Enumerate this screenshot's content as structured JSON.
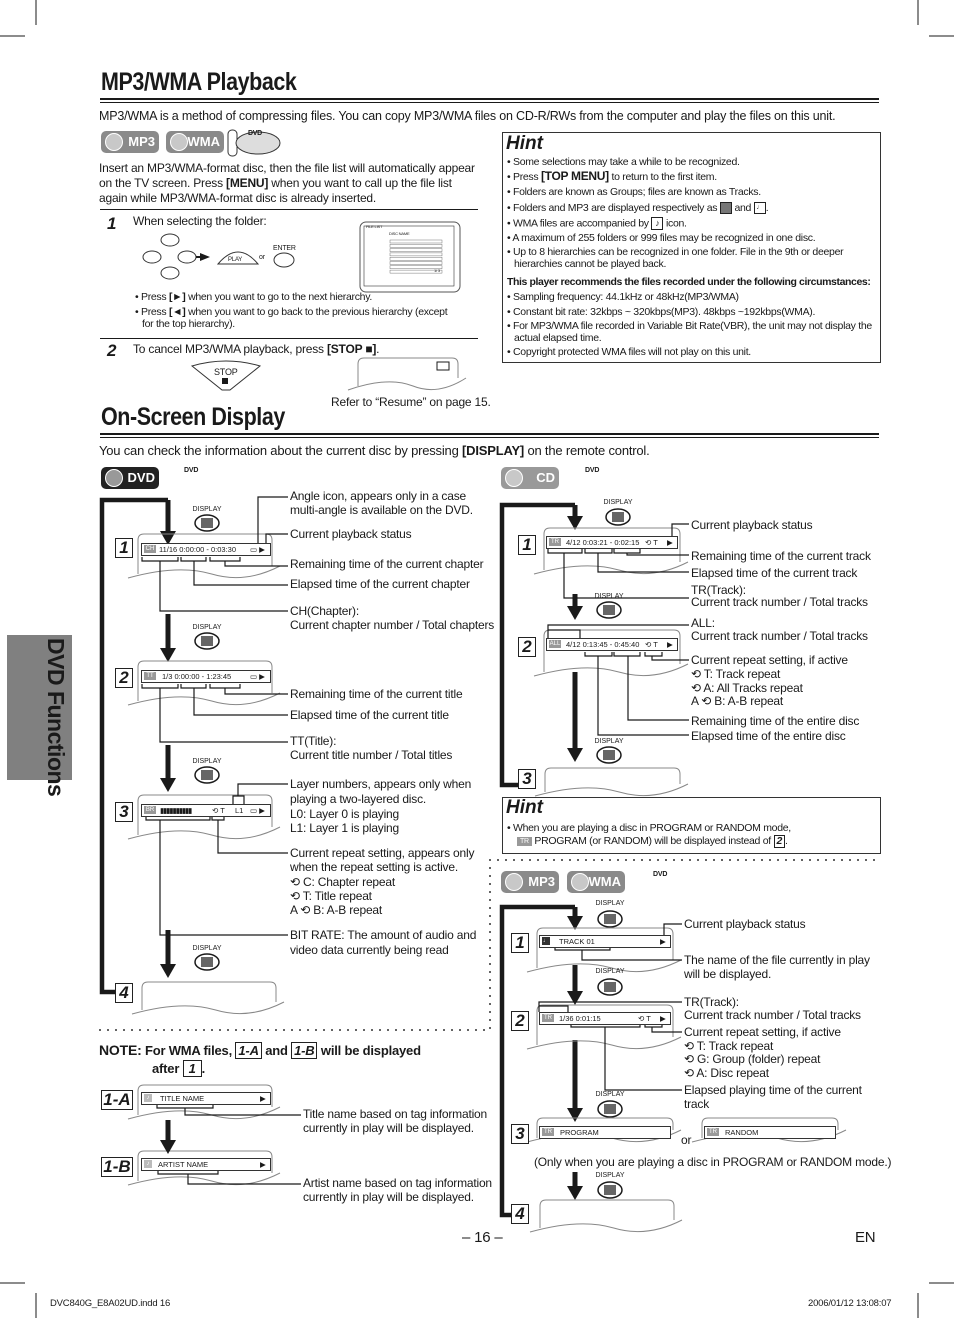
{
  "mp3wma": {
    "title": "MP3/WMA Playback",
    "intro": "MP3/WMA is a method of compressing files. You can copy MP3/WMA files on CD-R/RWs from the computer and play the files on this unit.",
    "format_icons": [
      "MP3",
      "WMA",
      "DVD"
    ],
    "insert": {
      "line1": "Insert an MP3/WMA-format disc, then the file list will automatically appear",
      "line2_a": "on the TV screen. Press ",
      "line2_b": "[MENU]",
      "line2_c": " when you want to call up the file list",
      "line3": "again while MP3/WMA-format disc is already inserted."
    },
    "step1": {
      "num": "1",
      "text": "When selecting the folder:",
      "play_label": "PLAY",
      "or": "or",
      "enter_label": "ENTER",
      "bullet1_a": "• Press ",
      "bullet1_b": "[►]",
      "bullet1_c": " when you want to go to the next hierarchy.",
      "bullet2_a": "• Press ",
      "bullet2_b": "[◄]",
      "bullet2_c": " when you want to go back to the previous hierarchy (except",
      "bullet2_d": "for the top hierarchy).",
      "file_list": {
        "header": "FILE LIST",
        "disc_name": "DISC NAME",
        "page": "1/ 3"
      }
    },
    "step2": {
      "num": "2",
      "text_a": "To cancel MP3/WMA playback, press ",
      "text_b": "[STOP ■]",
      "text_c": ".",
      "stop_label": "STOP",
      "resume_ref": "Refer to “Resume” on page 15."
    },
    "hint": {
      "title": "Hint",
      "items": [
        "• Some selections may take a while to be recognized.",
        "• Press [TOP MENU] to return to the first item.",
        "• Folders are known as Groups; files are known as Tracks.",
        "• Folders and MP3 are displayed respectively as",
        "• WMA files are accompanied by",
        "• A maximum of 255 folders or 999 files may be recognized in one disc.",
        "• Up to 8 hierarchies can be recognized in one folder. File in the 9th or deeper",
        "hierarchies cannot be played back."
      ],
      "and": "and",
      "icon_suffix": "icon.",
      "press_a": "• Press ",
      "press_b": "[TOP MENU]",
      "press_c": " to return to the first item.",
      "recommend_heading": "This player recommends the files recorded under the following circumstances:",
      "recommend": [
        "• Sampling frequency: 44.1kHz or 48kHz(MP3/WMA)",
        "• Constant bit rate: 32kbps ~ 320kbps(MP3). 48kbps ~192kbps(WMA).",
        "• For MP3/WMA file recorded in Variable Bit Rate(VBR), the unit may not display the",
        "actual elapsed time.",
        "• Copyright protected WMA files will not play on this unit."
      ]
    }
  },
  "osd": {
    "title": "On-Screen Display",
    "intro_a": "You can check the information about the current disc by pressing ",
    "intro_b": "[DISPLAY]",
    "intro_c": " on the remote control.",
    "display_label": "DISPLAY",
    "dvd": {
      "format_icons": [
        "DVD",
        "DVD"
      ],
      "steps": [
        "1",
        "2",
        "3",
        "4"
      ],
      "screen1": {
        "icon": "CH",
        "text": "11/16  0:00:00 - 0:03:30"
      },
      "screen2": {
        "icon": "TT",
        "text": "1/3      0:00:00 - 1:23:45"
      },
      "screen3": {
        "icon": "BR",
        "bars": "▮▮▮▮▮▮▮▮▮▮",
        "repeat": "⟲ T",
        "layer": "L1"
      },
      "labels": {
        "angle": [
          "Angle icon, appears only in a case",
          "multi-angle is available on the DVD."
        ],
        "status": "Current playback status",
        "rem_chapter": "Remaining time of the current chapter",
        "ela_chapter": "Elapsed time of the current chapter",
        "chapter": [
          "CH(Chapter):",
          "Current chapter number / Total chapters"
        ],
        "rem_title": "Remaining time of the current title",
        "ela_title": "Elapsed time of the current title",
        "title": [
          "TT(Title):",
          "Current title number / Total titles"
        ],
        "layer": [
          "Layer numbers, appears only when",
          "playing a two-layered disc.",
          "L0: Layer 0 is playing",
          "L1: Layer 1 is playing"
        ],
        "repeat": [
          "Current repeat setting, appears only",
          "when the repeat setting is active.",
          "⟲ C: Chapter repeat",
          "⟲ T: Title repeat",
          "A ⟲ B: A-B repeat"
        ],
        "bitrate": [
          "BIT RATE: The amount of audio and",
          "video data currently being read"
        ]
      }
    },
    "cd": {
      "format_icons": [
        "CD",
        "DVD"
      ],
      "steps": [
        "1",
        "2",
        "3"
      ],
      "screen1": {
        "icon": "TR",
        "text": "4/12  0:03:21 - 0:02:15",
        "repeat": "⟲ T"
      },
      "screen2": {
        "icon": "ALL",
        "text": "4/12  0:13:45 - 0:45:40",
        "repeat": "⟲ T"
      },
      "labels": {
        "status": "Current playback status",
        "rem_track": "Remaining time of the current track",
        "ela_track": "Elapsed time of the current track",
        "track": [
          "TR(Track):",
          "Current track number / Total tracks"
        ],
        "all": [
          "ALL:",
          "Current track number / Total tracks"
        ],
        "repeat": [
          "Current repeat setting, if active",
          "⟲ T: Track repeat",
          "⟲ A: All Tracks repeat",
          "A ⟲ B: A-B repeat"
        ],
        "rem_disc": "Remaining time of the entire disc",
        "ela_disc": "Elapsed time of the entire disc"
      }
    },
    "hint2": {
      "title": "Hint",
      "line1": "• When you are playing a disc in PROGRAM or RANDOM mode,",
      "icon": "TR",
      "line2": "PROGRAM (or RANDOM) will be displayed instead of",
      "ref": "2",
      "end": "."
    },
    "mp3": {
      "format_icons": [
        "MP3",
        "WMA",
        "DVD"
      ],
      "steps": [
        "1",
        "2",
        "3",
        "4"
      ],
      "screen1": {
        "text": "TRACK 01"
      },
      "screen2": {
        "icon": "TR",
        "text": "1/36  0:01:15",
        "repeat": "⟲ T"
      },
      "screen3a": {
        "icon": "TR",
        "text": "PROGRAM"
      },
      "or": "or",
      "screen3b": {
        "icon": "TR",
        "text": "RANDOM"
      },
      "only_when": "(Only when you are playing a disc in PROGRAM or RANDOM mode.)",
      "labels": {
        "status": "Current playback status",
        "name": [
          "The name of the file currently in play",
          "will be displayed."
        ],
        "track": [
          "TR(Track):",
          "Current track number / Total tracks"
        ],
        "repeat": [
          "Current repeat setting, if active",
          "⟲ T: Track repeat",
          "⟲ G: Group (folder) repeat",
          "⟲ A: Disc repeat"
        ],
        "elapsed": [
          "Elapsed playing time of the current",
          "track"
        ]
      }
    },
    "note": {
      "label": "NOTE:",
      "text_a": "For WMA files,",
      "ref_a": "1-A",
      "and": "and",
      "ref_b": "1-B",
      "text_b": "will be displayed",
      "after": "after",
      "ref_1": "1",
      "end": ".",
      "screen_a": "TITLE NAME",
      "screen_b": "ARTIST NAME",
      "label_a": [
        "Title name based on tag information",
        "currently in play will be displayed."
      ],
      "label_b": [
        "Artist name based on tag information",
        "currently in play will be displayed."
      ]
    }
  },
  "side_tab": "DVD Functions",
  "page_number": "– 16 –",
  "language": "EN",
  "footer": {
    "file": "DVC840G_E8A02UD.indd   16",
    "timestamp": "2006/01/12   13:08:07"
  },
  "colors": {
    "text": "#1a1a1a",
    "tab": "#808080",
    "icon_gray": "#8a8a8a"
  }
}
